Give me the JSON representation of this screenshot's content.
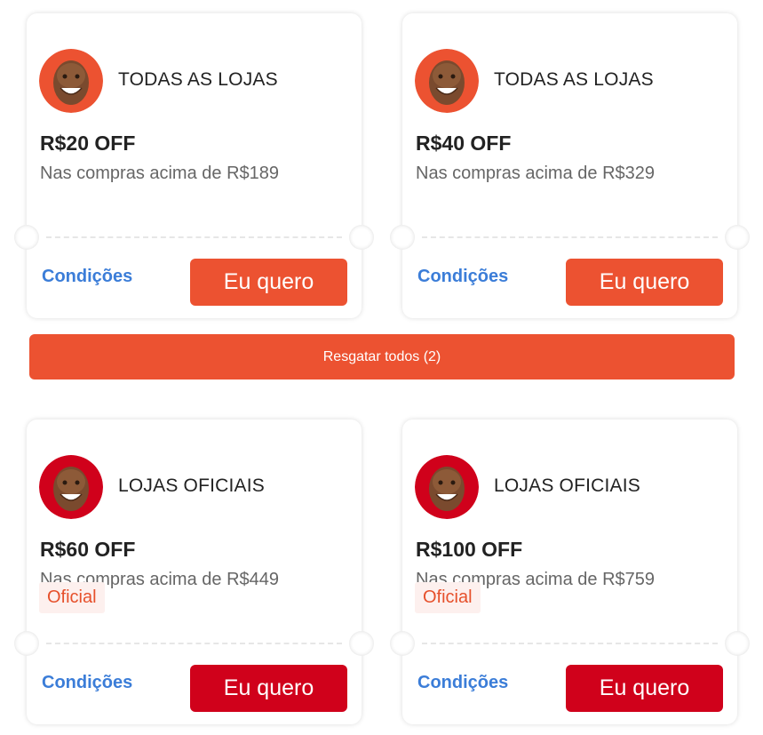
{
  "coupons": [
    {
      "store": "TODAS AS LOJAS",
      "discount": "R$20 OFF",
      "condition": "Nas compras acima de R$189",
      "conditions_link": "Condições",
      "button_label": "Eu quero",
      "avatar_color": "#ec5231",
      "button_color": "#ec5231"
    },
    {
      "store": "TODAS AS LOJAS",
      "discount": "R$40 OFF",
      "condition": "Nas compras acima de R$329",
      "conditions_link": "Condições",
      "button_label": "Eu quero",
      "avatar_color": "#ec5231",
      "button_color": "#ec5231"
    },
    {
      "store": "LOJAS OFICIAIS",
      "discount": "R$60 OFF",
      "condition": "Nas compras acima de R$449",
      "badge": "Oficial",
      "conditions_link": "Condições",
      "button_label": "Eu quero",
      "avatar_color": "#d0011b",
      "button_color": "#d0011b"
    },
    {
      "store": "LOJAS OFICIAIS",
      "discount": "R$100 OFF",
      "condition": "Nas compras acima de R$759",
      "badge": "Oficial",
      "conditions_link": "Condições",
      "button_label": "Eu quero",
      "avatar_color": "#d0011b",
      "button_color": "#d0011b"
    }
  ],
  "claim_all": {
    "label": "Resgatar todos (2)"
  },
  "colors": {
    "accent_orange": "#ec5231",
    "accent_red": "#d0011b",
    "link_blue": "#3b7dd8"
  },
  "icons": {
    "avatar": "person-face-avatar-icon"
  }
}
